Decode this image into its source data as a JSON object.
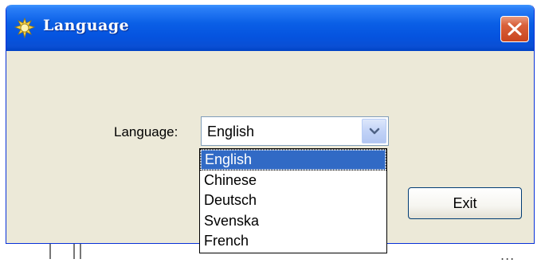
{
  "window": {
    "title": "Language",
    "title_icon": "gear-sun-icon",
    "close_icon": "close-icon"
  },
  "form": {
    "language_label": "Language:",
    "language_select": {
      "value": "English",
      "dropdown_icon": "chevron-down-icon",
      "options": [
        "English",
        "Chinese",
        "Deutsch",
        "Svenska",
        "French"
      ],
      "highlighted": "English"
    },
    "exit_label": "Exit"
  },
  "colors": {
    "titlebar": "#0553df",
    "client_bg": "#ece9d8",
    "close_button": "#d9603a",
    "highlight": "#316ac5"
  },
  "background": {
    "dots": "..."
  }
}
